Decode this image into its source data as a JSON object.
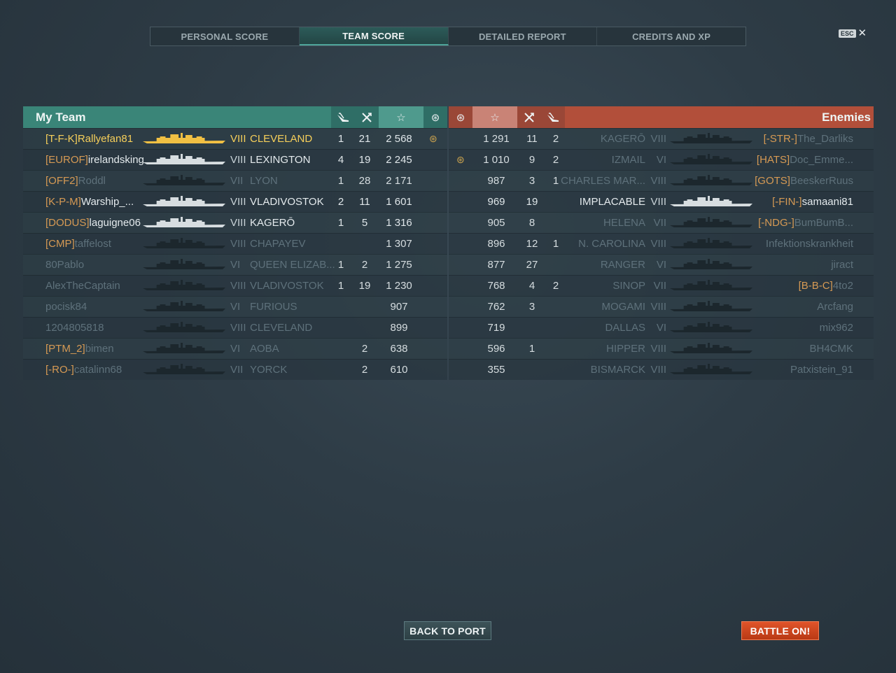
{
  "tabs": [
    {
      "label": "PERSONAL SCORE",
      "active": false
    },
    {
      "label": "TEAM SCORE",
      "active": true
    },
    {
      "label": "DETAILED REPORT",
      "active": false
    },
    {
      "label": "CREDITS AND XP",
      "active": false
    }
  ],
  "esc": {
    "key": "ESC",
    "close": "✕"
  },
  "my_team": {
    "title": "My Team",
    "header_icons": [
      "plane-icon",
      "swords-icon",
      "star-icon",
      "emblem-icon"
    ],
    "header_glyphs": {
      "planes": "⛵",
      "frags": "✕",
      "xp": "☆",
      "emblem": "⊛"
    },
    "rows": [
      {
        "clan": "[T-F-K]",
        "name": "Rallyefan81",
        "tier": "VIII",
        "ship": "CLEVELAND",
        "planes": "1",
        "frags": "21",
        "xp": "2 568",
        "emblem": true,
        "state": "me"
      },
      {
        "clan": "[EUROF]",
        "name": "irelandsking",
        "tier": "VIII",
        "ship": "LEXINGTON",
        "planes": "4",
        "frags": "19",
        "xp": "2 245",
        "emblem": false,
        "state": "alive"
      },
      {
        "clan": "[OFF2]",
        "name": "Roddl",
        "tier": "VII",
        "ship": "LYON",
        "planes": "1",
        "frags": "28",
        "xp": "2 171",
        "emblem": false,
        "state": "dead"
      },
      {
        "clan": "[K-P-M]",
        "name": "Warship_...",
        "tier": "VIII",
        "ship": "VLADIVOSTOK",
        "planes": "2",
        "frags": "11",
        "xp": "1 601",
        "emblem": false,
        "state": "alive"
      },
      {
        "clan": "[DODUS]",
        "name": "laguigne06",
        "tier": "VIII",
        "ship": "KAGERŌ",
        "planes": "1",
        "frags": "5",
        "xp": "1 316",
        "emblem": false,
        "state": "alive"
      },
      {
        "clan": "[CMP]",
        "name": "taffelost",
        "tier": "VIII",
        "ship": "CHAPAYEV",
        "planes": "",
        "frags": "",
        "xp": "1 307",
        "emblem": false,
        "state": "dead"
      },
      {
        "clan": "",
        "name": "80Pablo",
        "tier": "VI",
        "ship": "QUEEN ELIZAB...",
        "planes": "1",
        "frags": "2",
        "xp": "1 275",
        "emblem": false,
        "state": "dead"
      },
      {
        "clan": "",
        "name": "AlexTheCaptain",
        "tier": "VIII",
        "ship": "VLADIVOSTOK",
        "planes": "1",
        "frags": "19",
        "xp": "1 230",
        "emblem": false,
        "state": "dead"
      },
      {
        "clan": "",
        "name": "pocisk84",
        "tier": "VI",
        "ship": "FURIOUS",
        "planes": "",
        "frags": "",
        "xp": "907",
        "emblem": false,
        "state": "dead"
      },
      {
        "clan": "",
        "name": "1204805818",
        "tier": "VIII",
        "ship": "CLEVELAND",
        "planes": "",
        "frags": "",
        "xp": "899",
        "emblem": false,
        "state": "dead"
      },
      {
        "clan": "[PTM_2]",
        "name": "bimen",
        "tier": "VI",
        "ship": "AOBA",
        "planes": "",
        "frags": "2",
        "xp": "638",
        "emblem": false,
        "state": "dead"
      },
      {
        "clan": "[-RO-]",
        "name": "catalinn68",
        "tier": "VII",
        "ship": "YORCK",
        "planes": "",
        "frags": "2",
        "xp": "610",
        "emblem": false,
        "state": "dead"
      }
    ]
  },
  "enemies": {
    "title": "Enemies",
    "rows": [
      {
        "emblem": false,
        "xp": "1 291",
        "frags": "11",
        "planes": "2",
        "ship": "KAGERŌ",
        "tier": "VIII",
        "clan": "[-STR-]",
        "name": "The_Darliks",
        "state": "dead"
      },
      {
        "emblem": true,
        "xp": "1 010",
        "frags": "9",
        "planes": "2",
        "ship": "IZMAIL",
        "tier": "VI",
        "clan": "[HATS]",
        "name": "Doc_Emme...",
        "state": "dead"
      },
      {
        "emblem": false,
        "xp": "987",
        "frags": "3",
        "planes": "1",
        "ship": "CHARLES MAR...",
        "tier": "VIII",
        "clan": "[GOTS]",
        "name": "BeeskerRuus",
        "state": "dead"
      },
      {
        "emblem": false,
        "xp": "969",
        "frags": "19",
        "planes": "",
        "ship": "IMPLACABLE",
        "tier": "VIII",
        "clan": "[-FIN-]",
        "name": "samaani81",
        "state": "alive"
      },
      {
        "emblem": false,
        "xp": "905",
        "frags": "8",
        "planes": "",
        "ship": "HELENA",
        "tier": "VII",
        "clan": "[-NDG-]",
        "name": "BumBumB...",
        "state": "dead"
      },
      {
        "emblem": false,
        "xp": "896",
        "frags": "12",
        "planes": "1",
        "ship": "N. CAROLINA",
        "tier": "VIII",
        "clan": "",
        "name": "Infektionskrankheit",
        "state": "dead"
      },
      {
        "emblem": false,
        "xp": "877",
        "frags": "27",
        "planes": "",
        "ship": "RANGER",
        "tier": "VI",
        "clan": "",
        "name": "jiract",
        "state": "dead"
      },
      {
        "emblem": false,
        "xp": "768",
        "frags": "4",
        "planes": "2",
        "ship": "SINOP",
        "tier": "VII",
        "clan": "[B-B-C]",
        "name": "4to2",
        "state": "dead"
      },
      {
        "emblem": false,
        "xp": "762",
        "frags": "3",
        "planes": "",
        "ship": "MOGAMI",
        "tier": "VIII",
        "clan": "",
        "name": "Arcfang",
        "state": "dead"
      },
      {
        "emblem": false,
        "xp": "719",
        "frags": "",
        "planes": "",
        "ship": "DALLAS",
        "tier": "VI",
        "clan": "",
        "name": "mix962",
        "state": "dead"
      },
      {
        "emblem": false,
        "xp": "596",
        "frags": "1",
        "planes": "",
        "ship": "HIPPER",
        "tier": "VIII",
        "clan": "",
        "name": "BH4CMK",
        "state": "dead"
      },
      {
        "emblem": false,
        "xp": "355",
        "frags": "",
        "planes": "",
        "ship": "BISMARCK",
        "tier": "VIII",
        "clan": "",
        "name": "Patxistein_91",
        "state": "dead"
      }
    ]
  },
  "buttons": {
    "back": "BACK TO PORT",
    "battle": "BATTLE ON!"
  },
  "colors": {
    "my_team": "#3a8578",
    "enemies": "#b24f3a",
    "self": "#f6cf5a",
    "clan": "#d69a54",
    "battle_button": "#d24a20"
  }
}
